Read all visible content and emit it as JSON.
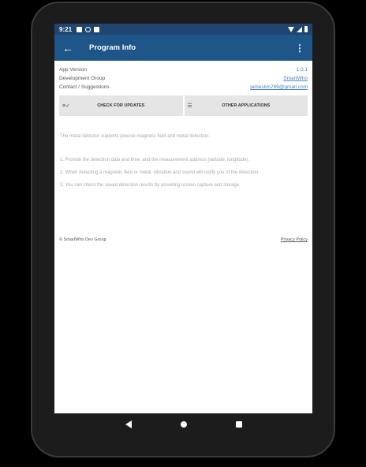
{
  "status_bar": {
    "time": "9:21"
  },
  "app_bar": {
    "title": "Program Info"
  },
  "info": [
    {
      "label": "App Version",
      "value": "1.0.1"
    },
    {
      "label": "Development Group",
      "value": "SmartWho"
    },
    {
      "label": "Contact / Suggestions",
      "value": "jameslim789@gmail.com"
    }
  ],
  "buttons": {
    "check_updates": "CHECK FOR UPDATES",
    "other_apps": "OTHER APPLICATIONS"
  },
  "description": "The metal detector supports precise magnetic field and metal detection.",
  "steps": [
    "1. Provide the detection date and time, and the measurement address (latitude, longitude).",
    "2. When detecting a magnetic field or metal, vibration and sound will notify you of the detection.",
    "3. You can check the saved detection results by providing screen capture and storage."
  ],
  "footer": {
    "copyright": "© SmartWho Dev Group",
    "privacy": "Privacy Policy"
  },
  "colors": {
    "appbar": "#1f5689",
    "statusbar": "#1f4570",
    "link": "#4a86c5"
  }
}
